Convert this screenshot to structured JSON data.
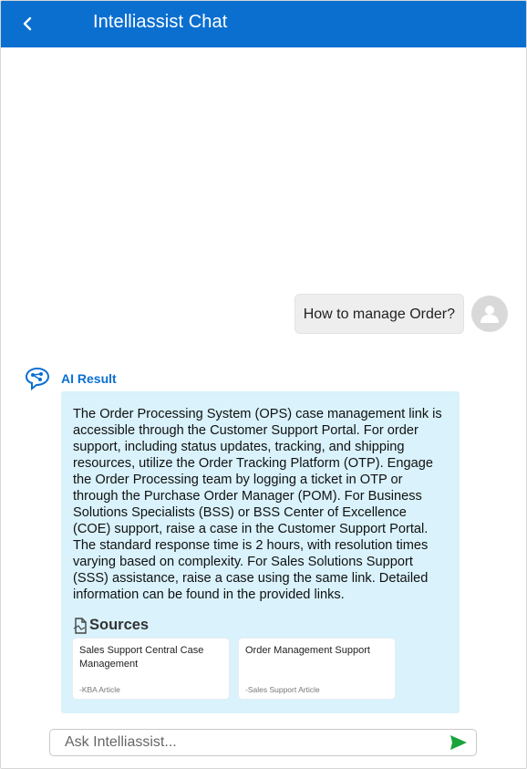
{
  "header": {
    "title": "Intelliassist Chat",
    "back_icon": "chevron-left-icon",
    "background": "#0b6fd0"
  },
  "conversation": {
    "user_message": "How to manage Order?",
    "user_avatar_icon": "user-avatar-icon",
    "ai_label": "AI Result",
    "ai_icon": "brain-network-icon",
    "ai_response": "The Order Processing System (OPS) case management link is accessible through the Customer Support Portal. For order support, including status updates, tracking, and shipping resources, utilize the Order Tracking Platform (OTP). Engage the Order Processing team by logging a ticket in OTP or through the Purchase Order Manager (POM). For Business Solutions Specialists (BSS) or BSS Center of Excellence (COE) support, raise a case in the Customer Support Portal. The standard response time is 2 hours, with resolution times varying based on complexity. For Sales Solutions Support (SSS) assistance, raise a case using the same link. Detailed information can be found in the provided links.",
    "sources_label": "Sources",
    "sources_icon": "document-icon",
    "sources": [
      {
        "title": "Sales Support Central Case Management",
        "type": "-KBA Article"
      },
      {
        "title": "Order Management Support",
        "type": "-Sales Support Article"
      }
    ]
  },
  "composer": {
    "placeholder": "Ask Intelliassist...",
    "value": "",
    "send_icon": "send-icon",
    "send_color": "#1aa33a"
  },
  "colors": {
    "accent": "#0b6fd0",
    "ai_card_bg": "#d9f2fb",
    "user_bubble_bg": "#eeeeee"
  }
}
